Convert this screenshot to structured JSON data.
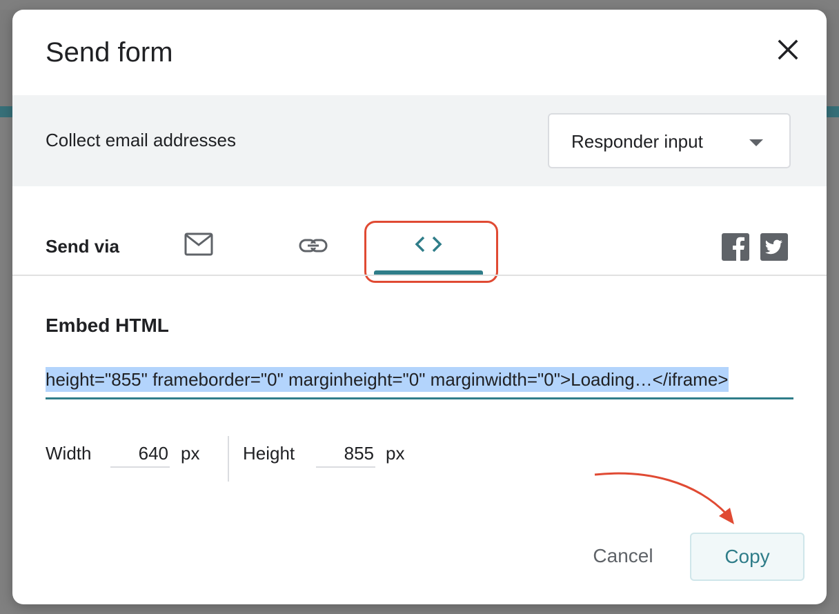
{
  "dialog": {
    "title": "Send form",
    "close_icon": "close-icon"
  },
  "collect": {
    "label": "Collect email addresses",
    "select_value": "Responder input"
  },
  "send_via": {
    "label": "Send via",
    "tabs": [
      {
        "icon": "email-icon",
        "active": false
      },
      {
        "icon": "link-icon",
        "active": false
      },
      {
        "icon": "embed-code-icon",
        "active": true
      }
    ],
    "social": [
      "facebook-icon",
      "twitter-icon"
    ]
  },
  "embed": {
    "title": "Embed HTML",
    "code": "height=\"855\" frameborder=\"0\" marginheight=\"0\" marginwidth=\"0\">Loading…</iframe>"
  },
  "dimensions": {
    "width_label": "Width",
    "width_value": "640",
    "height_label": "Height",
    "height_value": "855",
    "unit": "px"
  },
  "footer": {
    "cancel_label": "Cancel",
    "copy_label": "Copy"
  },
  "colors": {
    "accent": "#2f7d89",
    "annotation": "#e04a33"
  }
}
